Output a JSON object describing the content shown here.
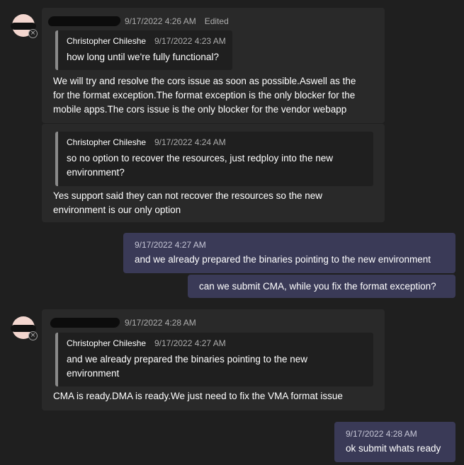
{
  "messages": [
    {
      "sender": "",
      "time": "9/17/2022 4:26 AM",
      "edited": "Edited",
      "quote": {
        "author": "Christopher Chileshe",
        "time": "9/17/2022 4:23 AM",
        "text": "how long until we're fully functional?"
      },
      "lines": [
        "We will try and resolve the cors issue as soon as possible.Aswell as the",
        "for the format exception.The format exception is the only blocker for the",
        "mobile apps.The cors issue is the only blocker for the vendor webapp"
      ]
    },
    {
      "quote": {
        "author": "Christopher Chileshe",
        "time": "9/17/2022 4:24 AM",
        "lines": [
          "so no option to recover the resources, just redploy into the new",
          "environment?"
        ]
      },
      "lines": [
        "Yes support said they can not recover the resources so the new",
        "environment is our only option"
      ]
    },
    {
      "time": "9/17/2022 4:27 AM",
      "text": "and we already prepared the binaries pointing to the new environment"
    },
    {
      "text": "can we submit CMA, while you fix the format exception?"
    },
    {
      "sender": "",
      "time": "9/17/2022 4:28 AM",
      "quote": {
        "author": "Christopher Chileshe",
        "time": "9/17/2022 4:27 AM",
        "lines": [
          "and we already prepared the binaries pointing to the new",
          "environment"
        ]
      },
      "text": "CMA is ready.DMA is ready.We just need to fix the VMA format issue"
    },
    {
      "time": "9/17/2022 4:28 AM",
      "text": "ok submit whats ready"
    }
  ],
  "status_icon": "offline-x-icon",
  "colors": {
    "background": "#1f1f1f",
    "incoming": "#292929",
    "outgoing": "#3a3a57",
    "quote_bar": "#8a8a8a"
  }
}
